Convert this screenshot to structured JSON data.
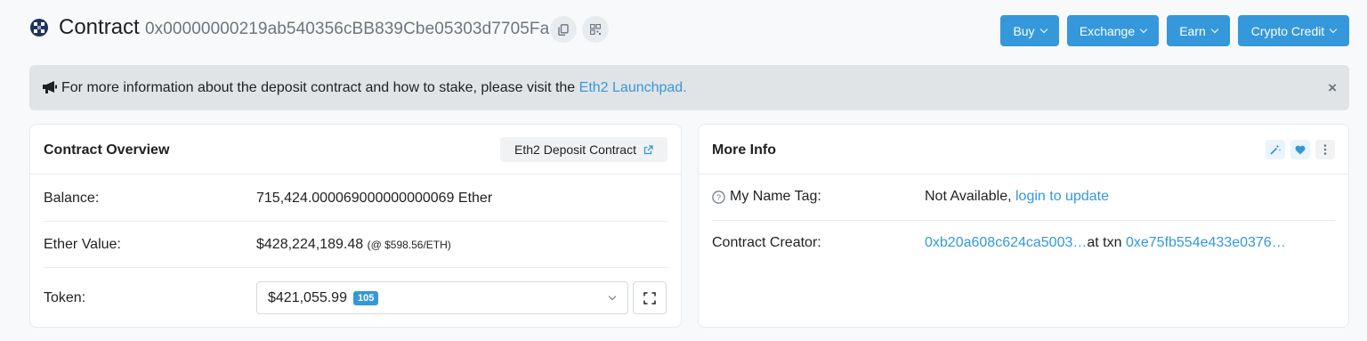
{
  "header": {
    "title": "Contract",
    "address": "0x00000000219ab540356cBB839Cbe05303d7705Fa",
    "copy_icon": "copy-icon",
    "qr_icon": "qr-code-icon",
    "menus": [
      {
        "label": "Buy"
      },
      {
        "label": "Exchange"
      },
      {
        "label": "Earn"
      },
      {
        "label": "Crypto Credit"
      }
    ]
  },
  "alert": {
    "text": "For more information about the deposit contract and how to stake, please visit the",
    "link_text": "Eth2 Launchpad.",
    "close": "×"
  },
  "overview": {
    "title": "Contract Overview",
    "tag_button": "Eth2 Deposit Contract",
    "balance_label": "Balance:",
    "balance_value": "715,424.000069000000000069 Ether",
    "ether_value_label": "Ether Value:",
    "ether_value": "$428,224,189.48",
    "ether_price": "(@ $598.56/ETH)",
    "token_label": "Token:",
    "token_amount": "$421,055.99",
    "token_count": "105"
  },
  "more_info": {
    "title": "More Info",
    "name_tag_label": "My Name Tag:",
    "name_tag_value": "Not Available,",
    "name_tag_link": "login to update",
    "creator_label": "Contract Creator:",
    "creator_address": "0xb20a608c624ca5003…",
    "creator_at_txn": "at txn",
    "creator_txn": "0xe75fb554e433e0376…"
  },
  "colors": {
    "accent": "#3498db",
    "text": "#1e2022",
    "muted": "#6c757e"
  }
}
